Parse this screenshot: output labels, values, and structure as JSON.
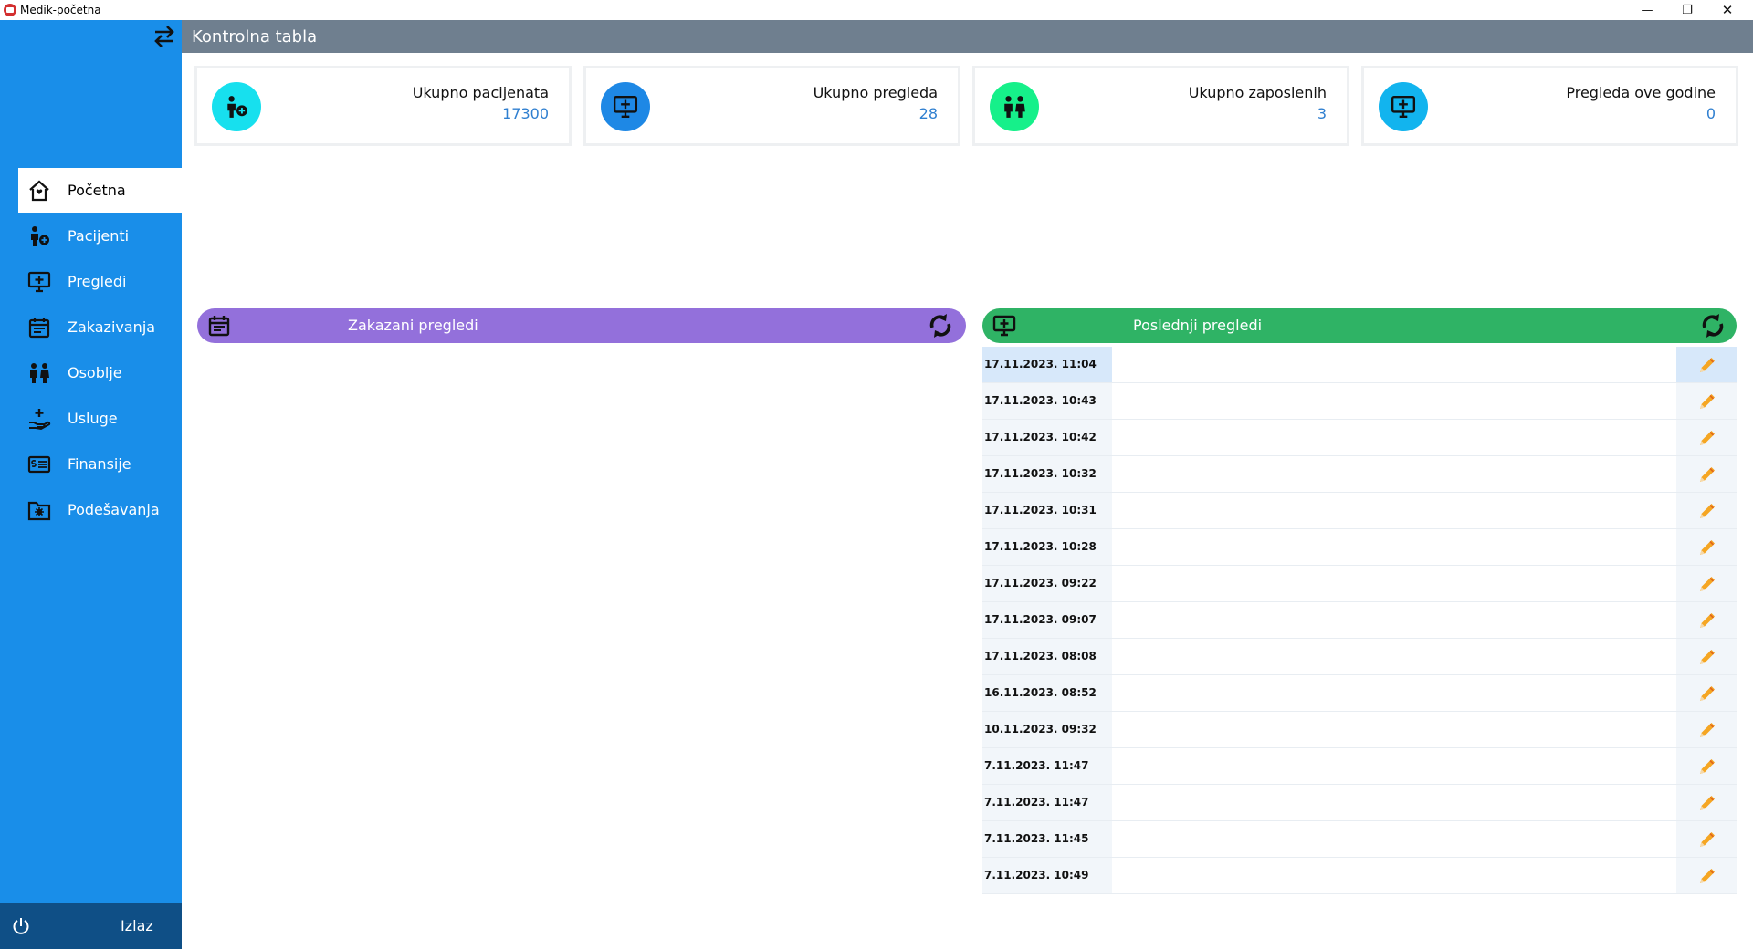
{
  "window": {
    "title": "Medik-početna",
    "controls": {
      "minimize": "—",
      "maximize": "❐",
      "close": "✕"
    }
  },
  "sidebar": {
    "items": [
      {
        "label": "Početna",
        "icon": "home-icon",
        "active": true
      },
      {
        "label": "Pacijenti",
        "icon": "patient-add-icon",
        "active": false
      },
      {
        "label": "Pregledi",
        "icon": "monitor-plus-icon",
        "active": false
      },
      {
        "label": "Zakazivanja",
        "icon": "calendar-icon",
        "active": false
      },
      {
        "label": "Osoblje",
        "icon": "people-icon",
        "active": false
      },
      {
        "label": "Usluge",
        "icon": "hand-plus-icon",
        "active": false
      },
      {
        "label": "Finansije",
        "icon": "money-icon",
        "active": false
      },
      {
        "label": "Podešavanja",
        "icon": "folder-gear-icon",
        "active": false
      }
    ],
    "exit_label": "Izlaz"
  },
  "header": {
    "title": "Kontrolna tabla"
  },
  "stats": [
    {
      "label": "Ukupno pacijenata",
      "value": "17300",
      "color": "#17e0ee",
      "icon": "patient-add-icon"
    },
    {
      "label": "Ukupno pregleda",
      "value": "28",
      "color": "#1e88e5",
      "icon": "monitor-plus-icon"
    },
    {
      "label": "Ukupno zaposlenih",
      "value": "3",
      "color": "#16f08a",
      "icon": "people-icon"
    },
    {
      "label": "Pregleda ove godine",
      "value": "0",
      "color": "#12b4ee",
      "icon": "monitor-plus-icon"
    }
  ],
  "scheduled": {
    "title": "Zakazani pregledi",
    "color": "#9370db"
  },
  "recent": {
    "title": "Poslednji pregledi",
    "color": "#2fb365",
    "rows": [
      {
        "date": "17.11.2023. 11:04"
      },
      {
        "date": "17.11.2023. 10:43"
      },
      {
        "date": "17.11.2023. 10:42"
      },
      {
        "date": "17.11.2023. 10:32"
      },
      {
        "date": "17.11.2023. 10:31"
      },
      {
        "date": "17.11.2023. 10:28"
      },
      {
        "date": "17.11.2023. 09:22"
      },
      {
        "date": "17.11.2023. 09:07"
      },
      {
        "date": "17.11.2023. 08:08"
      },
      {
        "date": "16.11.2023. 08:52"
      },
      {
        "date": "10.11.2023. 09:32"
      },
      {
        "date": "7.11.2023. 11:47"
      },
      {
        "date": "7.11.2023. 11:47"
      },
      {
        "date": "7.11.2023. 11:45"
      },
      {
        "date": "7.11.2023. 10:49"
      }
    ]
  }
}
